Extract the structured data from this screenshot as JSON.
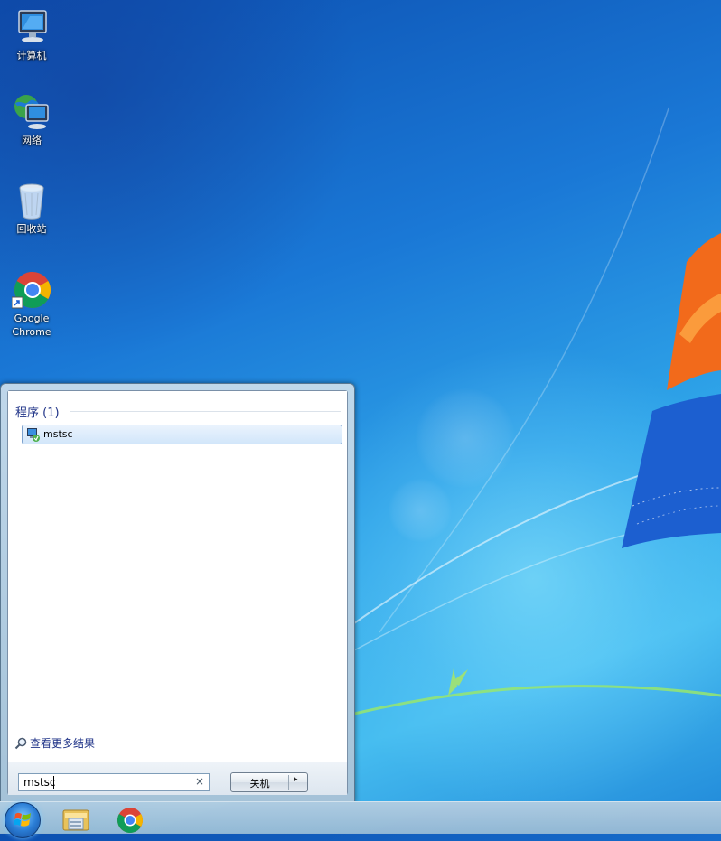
{
  "desktop": {
    "icons": [
      {
        "label": "计算机",
        "icon": "computer-icon"
      },
      {
        "label": "网络",
        "icon": "network-icon"
      },
      {
        "label": "回收站",
        "icon": "recycle-bin-icon"
      },
      {
        "label": "Google\nChrome",
        "icon": "chrome-icon"
      }
    ]
  },
  "start_menu": {
    "section_header": "程序 (1)",
    "results": [
      {
        "label": "mstsc",
        "icon": "remote-desktop-icon"
      }
    ],
    "see_more": "查看更多结果",
    "search": {
      "value": "mstsc",
      "clear": "×"
    },
    "shutdown": {
      "label": "关机",
      "arrow": "▸"
    }
  },
  "taskbar": {
    "items": [
      "start-button",
      "file-explorer-icon",
      "chrome-icon"
    ]
  },
  "colors": {
    "accent": "#1e3287",
    "selection": "#d2e6fa"
  }
}
